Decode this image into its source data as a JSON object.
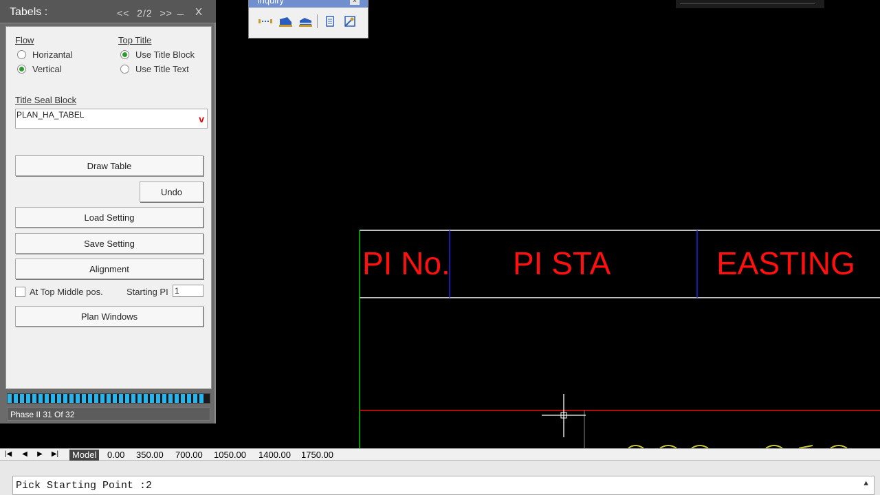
{
  "palette": {
    "title": "Tabels :",
    "nav_prev": "<<",
    "page": "2/2",
    "nav_next": ">>",
    "minimize": "_",
    "close": "X",
    "flow": {
      "label": "Flow",
      "options": [
        "Horizantal",
        "Vertical"
      ],
      "selected": "Vertical"
    },
    "top_title": {
      "label": "Top Title",
      "options": [
        "Use Title Block",
        "Use Title Text"
      ],
      "selected": "Use Title Block"
    },
    "title_seal": {
      "label": "Title Seal Block",
      "value": "PLAN_HA_TABEL",
      "chevron": "v"
    },
    "buttons": {
      "draw_table": "Draw Table",
      "undo": "Undo",
      "load_setting": "Load Setting",
      "save_setting": "Save Setting",
      "alignment": "Alignment",
      "plan_windows": "Plan Windows"
    },
    "top_middle_label": "At Top Middle pos.",
    "top_middle_checked": false,
    "starting_pi_label": "Starting PI",
    "starting_pi_value": "1",
    "progress_fraction": 0.97,
    "phase_text": "Phase II 31 Of 32",
    "colors": {
      "accent": "#27b4ec",
      "radio_on": "#2e9b2e"
    }
  },
  "inquiry": {
    "title": "Inquiry",
    "close": "x",
    "icons": [
      "measure-distance-icon",
      "measure-area-icon",
      "measure-area-alt-icon",
      "list-properties-icon",
      "locate-point-icon"
    ]
  },
  "drawing": {
    "headers": [
      "PI No.",
      "PI STA",
      "EASTING"
    ],
    "colors": {
      "text": "#ff1010",
      "header_line": "#ffffff",
      "side_line": "#00cc00",
      "divider": "#2222ee",
      "row_line": "#ee1111"
    }
  },
  "layout_tabs": {
    "nav": [
      "|◀",
      "◀",
      "▶",
      "▶|"
    ],
    "tabs": [
      "Model",
      "0.00",
      "350.00",
      "700.00",
      "1050.00",
      "1400.00",
      "1750.00"
    ],
    "active": "Model"
  },
  "command_line": {
    "text": "Pick Starting Point :2"
  }
}
